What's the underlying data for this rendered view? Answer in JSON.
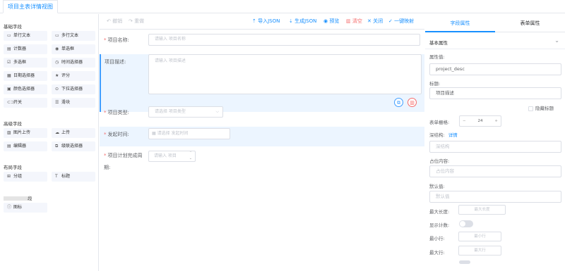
{
  "header": {
    "tab_label": "项目主表详情视图"
  },
  "sidebar": {
    "groups": [
      {
        "title": "基础字段",
        "items": [
          {
            "label": "单行文本",
            "icon": "textbox-icon",
            "glyph": "▭"
          },
          {
            "label": "多行文本",
            "icon": "textarea-icon",
            "glyph": "▭"
          },
          {
            "label": "计数器",
            "icon": "counter-icon",
            "glyph": "▤"
          },
          {
            "label": "单选框",
            "icon": "radio-icon",
            "glyph": "◉"
          },
          {
            "label": "多选框",
            "icon": "checkbox-icon",
            "glyph": "☑"
          },
          {
            "label": "时间选择器",
            "icon": "clock-icon",
            "glyph": "◷"
          },
          {
            "label": "日期选择器",
            "icon": "calendar-icon",
            "glyph": "▦"
          },
          {
            "label": "评分",
            "icon": "star-icon",
            "glyph": "★"
          },
          {
            "label": "颜色选择器",
            "icon": "color-icon",
            "glyph": "▣"
          },
          {
            "label": "下拉选择器",
            "icon": "dropdown-icon",
            "glyph": "⊙"
          },
          {
            "label": "开关",
            "icon": "switch-icon",
            "glyph": "⊂⊃"
          },
          {
            "label": "滑块",
            "icon": "slider-icon",
            "glyph": "☰"
          }
        ]
      },
      {
        "title": "高级字段",
        "items": [
          {
            "label": "图片上传",
            "icon": "image-upload-icon",
            "glyph": "▨"
          },
          {
            "label": "上传",
            "icon": "upload-icon",
            "glyph": "☁"
          },
          {
            "label": "编辑器",
            "icon": "editor-icon",
            "glyph": "▤"
          },
          {
            "label": "级联选择器",
            "icon": "cascader-icon",
            "glyph": "⧉"
          }
        ]
      },
      {
        "title": "布局字段",
        "items": [
          {
            "label": "分组",
            "icon": "group-icon",
            "glyph": "⊞"
          },
          {
            "label": "标题",
            "icon": "title-icon",
            "glyph": "T"
          }
        ]
      },
      {
        "title": "段",
        "items": [
          {
            "label": "图标",
            "icon": "info-icon",
            "glyph": "ⓘ"
          }
        ]
      }
    ]
  },
  "toolbar": {
    "undo": "撤销",
    "redo": "重做",
    "import_json": "导入JSON",
    "generate_json": "生成JSON",
    "preview": "预览",
    "clear": "清空",
    "close": "关闭",
    "one_click_map": "一键映射"
  },
  "form": {
    "project_name": {
      "label": "项目名称:",
      "placeholder": "请输入 项目名称"
    },
    "project_desc": {
      "label": "项目描述:",
      "placeholder": "请输入 项目描述"
    },
    "project_type": {
      "label": "项目类型:",
      "placeholder": "请选择 项目类型"
    },
    "start_time": {
      "label": "发起时间:",
      "placeholder": "请选择 发起时间"
    },
    "planned_days": {
      "label_line1": "项目计划完成周",
      "label_line2": "期:",
      "placeholder": "请输入 项目"
    }
  },
  "right_panel": {
    "tabs": [
      "字段属性",
      "表单属性"
    ],
    "section_title": "基本属性",
    "property_value": {
      "label": "属性值:",
      "value": "project_desc"
    },
    "title": {
      "label": "标题:",
      "value": "项目描述"
    },
    "hide_title": "隐藏标题",
    "grid": {
      "label": "表单栅格:",
      "value": "24"
    },
    "deep_struct": {
      "label": "深结构:",
      "link": "详情",
      "placeholder": "深结构"
    },
    "placeholder_field": {
      "label": "占位内容:",
      "placeholder": "占位内容"
    },
    "default_value": {
      "label": "默认值:",
      "placeholder": "默认值"
    },
    "max_length": {
      "label": "最大长度:",
      "placeholder": "最大长度"
    },
    "show_count": {
      "label": "显示计数:",
      "on": false
    },
    "min_rows": {
      "label": "最小行:",
      "placeholder": "最小行"
    },
    "max_rows": {
      "label": "最大行:",
      "placeholder": "最大行"
    }
  },
  "colors": {
    "accent": "#1890ff",
    "danger": "#f56c6c",
    "selected_bg": "#ecf5ff"
  }
}
